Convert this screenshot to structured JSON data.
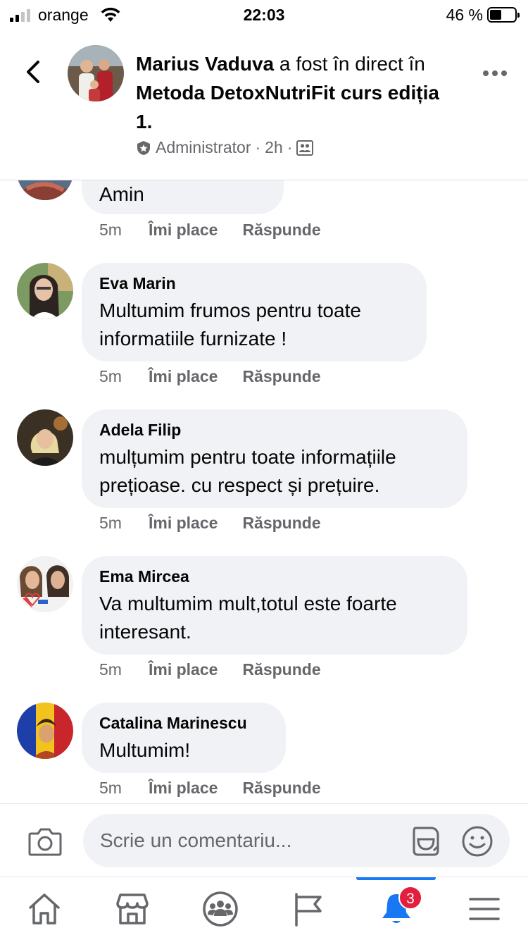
{
  "status_bar": {
    "carrier": "orange",
    "time": "22:03",
    "battery": "46 %",
    "battery_level": 0.46
  },
  "header": {
    "author": "Marius Vaduva",
    "connector": " a fost în direct în ",
    "group": "Metoda DetoxNutriFit curs ediția 1.",
    "role": "Administrator",
    "separator": "·",
    "age": "2h",
    "back_icon": "chevron-left-icon",
    "more_icon": "more-dots-icon"
  },
  "comments": [
    {
      "author": "",
      "text": "Amin",
      "time": "5m",
      "like": "Îmi place",
      "reply": "Răspunde"
    },
    {
      "author": "Eva Marin",
      "text": "Multumim frumos pentru toate informatiile furnizate !",
      "time": "5m",
      "like": "Îmi place",
      "reply": "Răspunde"
    },
    {
      "author": "Adela Filip",
      "text": "mulțumim pentru toate informațiile prețioase. cu respect și prețuire.",
      "time": "5m",
      "like": "Îmi place",
      "reply": "Răspunde"
    },
    {
      "author": "Ema Mircea",
      "text": "Va multumim mult,totul este foarte interesant.",
      "time": "5m",
      "like": "Îmi place",
      "reply": "Răspunde"
    },
    {
      "author": "Catalina Marinescu",
      "text": "Multumim!",
      "time": "5m",
      "like": "Îmi place",
      "reply": "Răspunde"
    }
  ],
  "composer": {
    "placeholder": "Scrie un comentariu...",
    "camera_icon": "camera-icon",
    "gif_icon": "gif-sticker-icon",
    "emoji_icon": "emoji-icon"
  },
  "tabbar": {
    "tabs": [
      {
        "name": "home-icon"
      },
      {
        "name": "marketplace-icon"
      },
      {
        "name": "groups-icon"
      },
      {
        "name": "pages-flag-icon"
      },
      {
        "name": "notifications-bell-icon",
        "active": true,
        "badge": "3"
      },
      {
        "name": "menu-icon"
      }
    ]
  },
  "colors": {
    "accent": "#1877f2",
    "badge": "#e41e3f",
    "bubble": "#f0f2f5",
    "secondary_text": "#65676b"
  }
}
